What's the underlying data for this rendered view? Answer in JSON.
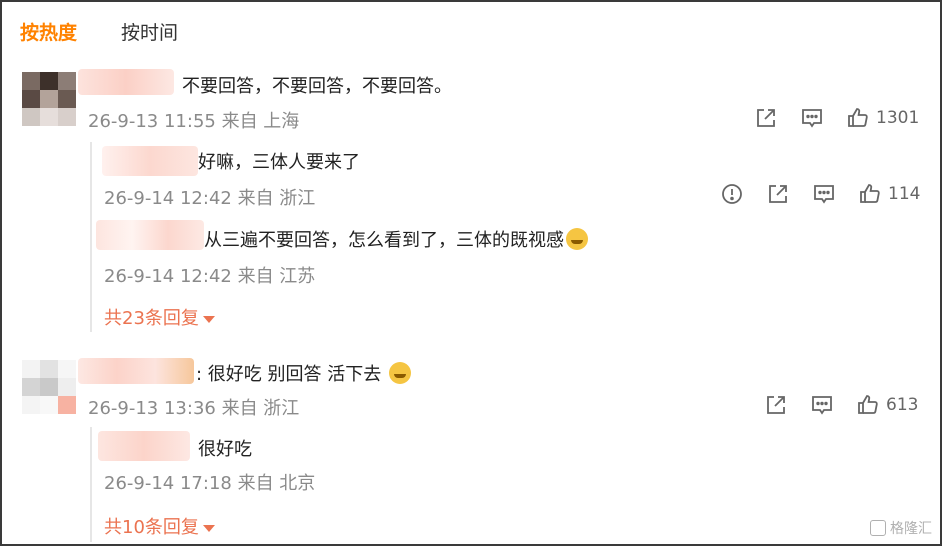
{
  "tabs": [
    {
      "label": "按热度",
      "active": true
    },
    {
      "label": "按时间",
      "active": false
    }
  ],
  "comments": [
    {
      "text": "不要回答，不要回答，不要回答。",
      "meta": "26-9-13 11:55 来自 上海",
      "likes": "1301",
      "replies": [
        {
          "text": "好嘛，三体人要来了",
          "meta": "26-9-14 12:42 来自 浙江",
          "likes": "114"
        },
        {
          "text": "从三遍不要回答，怎么看到了，三体的既视感",
          "meta": "26-9-14 12:42 来自 江苏"
        }
      ],
      "more_replies": "共23条回复"
    },
    {
      "text": ": 很好吃  别回答 活下去",
      "meta": "26-9-13 13:36 来自 浙江",
      "likes": "613",
      "replies": [
        {
          "text": "很好吃",
          "meta": "26-9-14 17:18 来自 北京"
        }
      ],
      "more_replies": "共10条回复"
    }
  ],
  "icons": [
    "share-icon",
    "comment-icon",
    "like-icon",
    "report-icon",
    "emoji-icon"
  ],
  "watermark": "格隆汇",
  "colors": {
    "accent": "#ff8200",
    "more_link": "#eb7350",
    "meta": "#8a8a8a"
  }
}
